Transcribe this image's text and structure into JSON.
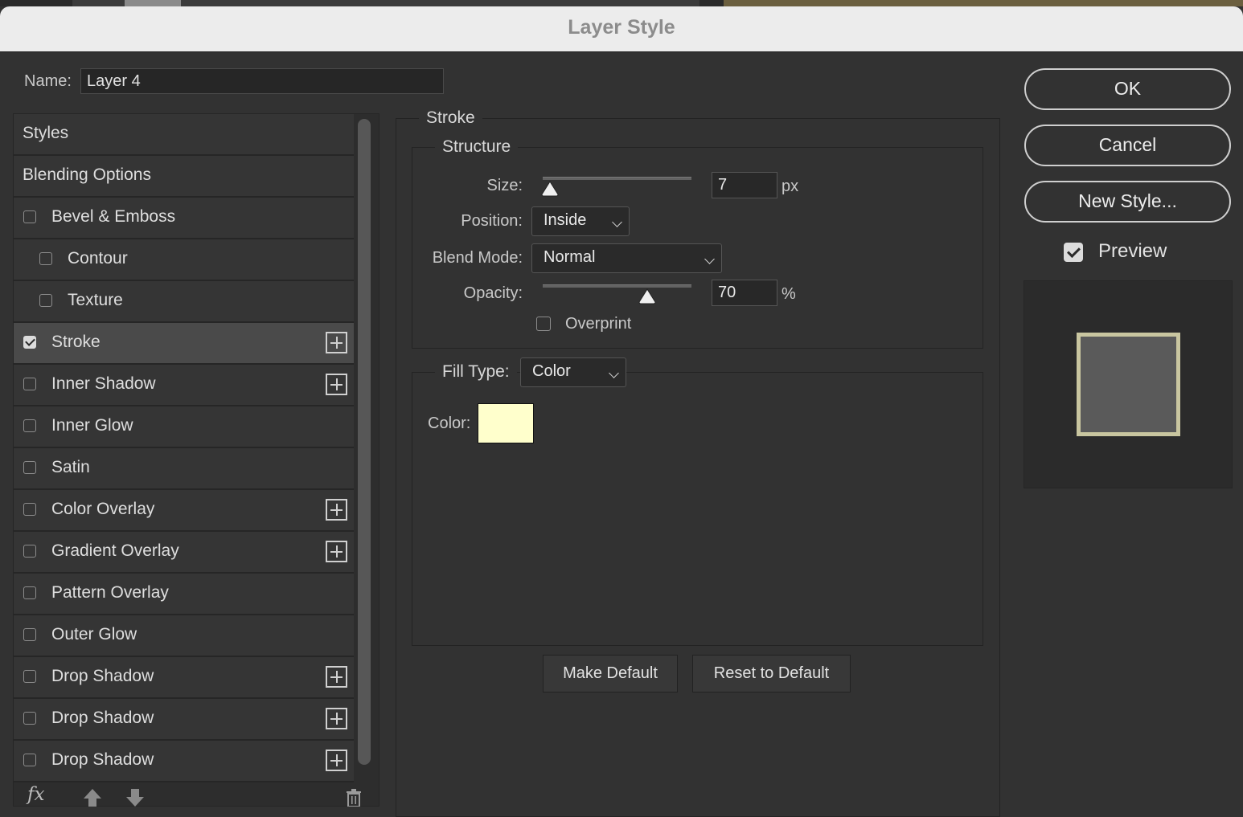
{
  "window": {
    "title": "Layer Style"
  },
  "name_field": {
    "label": "Name:",
    "value": "Layer 4"
  },
  "styles_list": [
    {
      "label": "Styles",
      "checkbox": false,
      "checked": false,
      "indent": false,
      "plus": false,
      "selected": false
    },
    {
      "label": "Blending Options",
      "checkbox": false,
      "checked": false,
      "indent": false,
      "plus": false,
      "selected": false
    },
    {
      "label": "Bevel & Emboss",
      "checkbox": true,
      "checked": false,
      "indent": false,
      "plus": false,
      "selected": false
    },
    {
      "label": "Contour",
      "checkbox": true,
      "checked": false,
      "indent": true,
      "plus": false,
      "selected": false
    },
    {
      "label": "Texture",
      "checkbox": true,
      "checked": false,
      "indent": true,
      "plus": false,
      "selected": false
    },
    {
      "label": "Stroke",
      "checkbox": true,
      "checked": true,
      "indent": false,
      "plus": true,
      "selected": true
    },
    {
      "label": "Inner Shadow",
      "checkbox": true,
      "checked": false,
      "indent": false,
      "plus": true,
      "selected": false
    },
    {
      "label": "Inner Glow",
      "checkbox": true,
      "checked": false,
      "indent": false,
      "plus": false,
      "selected": false
    },
    {
      "label": "Satin",
      "checkbox": true,
      "checked": false,
      "indent": false,
      "plus": false,
      "selected": false
    },
    {
      "label": "Color Overlay",
      "checkbox": true,
      "checked": false,
      "indent": false,
      "plus": true,
      "selected": false
    },
    {
      "label": "Gradient Overlay",
      "checkbox": true,
      "checked": false,
      "indent": false,
      "plus": true,
      "selected": false
    },
    {
      "label": "Pattern Overlay",
      "checkbox": true,
      "checked": false,
      "indent": false,
      "plus": false,
      "selected": false
    },
    {
      "label": "Outer Glow",
      "checkbox": true,
      "checked": false,
      "indent": false,
      "plus": false,
      "selected": false
    },
    {
      "label": "Drop Shadow",
      "checkbox": true,
      "checked": false,
      "indent": false,
      "plus": true,
      "selected": false
    },
    {
      "label": "Drop Shadow",
      "checkbox": true,
      "checked": false,
      "indent": false,
      "plus": true,
      "selected": false
    },
    {
      "label": "Drop Shadow",
      "checkbox": true,
      "checked": false,
      "indent": false,
      "plus": true,
      "selected": false
    }
  ],
  "list_toolbar": {
    "fx_label": "fx"
  },
  "stroke": {
    "title": "Stroke",
    "structure": {
      "title": "Structure",
      "size_label": "Size:",
      "size_value": "7",
      "size_unit": "px",
      "size_slider_fraction": 0.05,
      "position_label": "Position:",
      "position_value": "Inside",
      "blend_label": "Blend Mode:",
      "blend_value": "Normal",
      "opacity_label": "Opacity:",
      "opacity_value": "70",
      "opacity_unit": "%",
      "opacity_slider_fraction": 0.7,
      "overprint_label": "Overprint",
      "overprint_checked": false
    },
    "fill": {
      "type_label": "Fill Type:",
      "type_value": "Color",
      "color_label": "Color:",
      "color_value": "#ffffcc"
    },
    "make_default": "Make Default",
    "reset_default": "Reset to Default"
  },
  "actions": {
    "ok": "OK",
    "cancel": "Cancel",
    "new_style": "New Style...",
    "preview_label": "Preview",
    "preview_checked": true
  },
  "colors": {
    "preview_stroke": "#c9c6a0",
    "preview_fill": "#5a5a5a"
  }
}
